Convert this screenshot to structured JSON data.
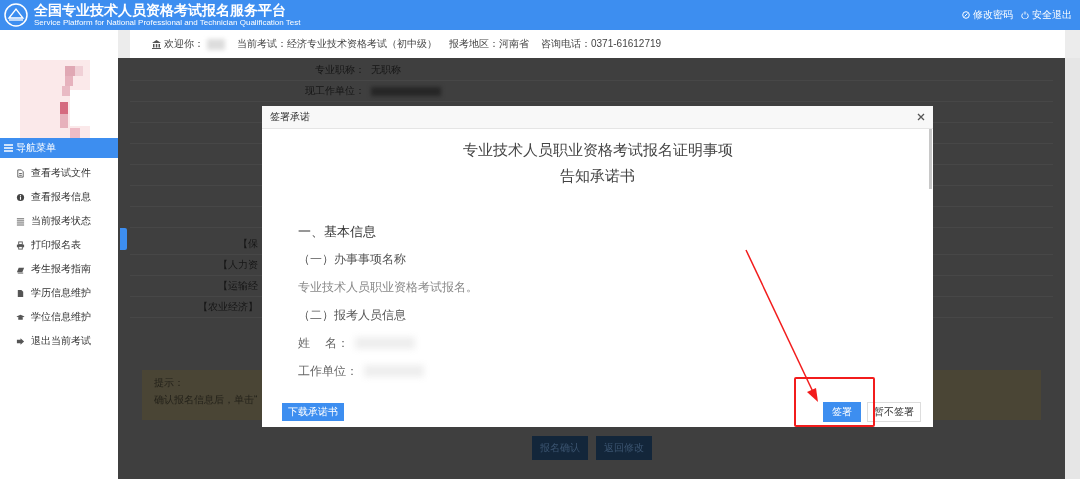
{
  "header": {
    "title": "全国专业技术人员资格考试报名服务平台",
    "subtitle": "Service Platform for National Professional and Technician Qualification Test",
    "links": [
      {
        "label": "修改密码",
        "kind": "edit"
      },
      {
        "label": "安全退出",
        "kind": "power"
      }
    ]
  },
  "info_bar": {
    "welcome": "欢迎你：",
    "exam": "当前考试：经济专业技术资格考试（初中级）",
    "region": "报考地区：河南省",
    "phone": "咨询电话：0371-61612719"
  },
  "sidebar": {
    "menu_title": "导航菜单",
    "items": [
      {
        "label": "查看考试文件",
        "kind": "file"
      },
      {
        "label": "查看报考信息",
        "kind": "info"
      },
      {
        "label": "当前报考状态",
        "kind": "list"
      },
      {
        "label": "打印报名表",
        "kind": "print"
      },
      {
        "label": "考生报考指南",
        "kind": "guide"
      },
      {
        "label": "学历信息维护",
        "kind": "doc"
      },
      {
        "label": "学位信息维护",
        "kind": "cap"
      },
      {
        "label": "退出当前考试",
        "kind": "exit"
      }
    ]
  },
  "page": {
    "fields": [
      {
        "label": "专业职称：",
        "value": "无职称"
      },
      {
        "label": "现工作单位："
      }
    ],
    "categories": [
      "【保",
      "【人力资",
      "【运输经",
      "【农业经济】"
    ],
    "notice": {
      "title": "提示：",
      "text": "确认报名信息后，单击“"
    },
    "buttons": [
      "报名确认",
      "返回修改"
    ]
  },
  "dialog": {
    "title": "签署承诺",
    "doc_title": "专业技术人员职业资格考试报名证明事项",
    "doc_subtitle": "告知承诺书",
    "paragraphs": [
      {
        "kind": "heading",
        "text": "一、基本信息"
      },
      {
        "kind": "subheading",
        "text": "（一）办事事项名称"
      },
      {
        "kind": "body",
        "text": "专业技术人员职业资格考试报名。"
      },
      {
        "kind": "subheading",
        "text": "（二）报考人员信息"
      },
      {
        "kind": "field",
        "text": "姓    名："
      },
      {
        "kind": "field",
        "text": "工作单位："
      }
    ],
    "download_button": "下载承诺书",
    "sign_button": "签署",
    "skip_button": "暂不签署"
  }
}
